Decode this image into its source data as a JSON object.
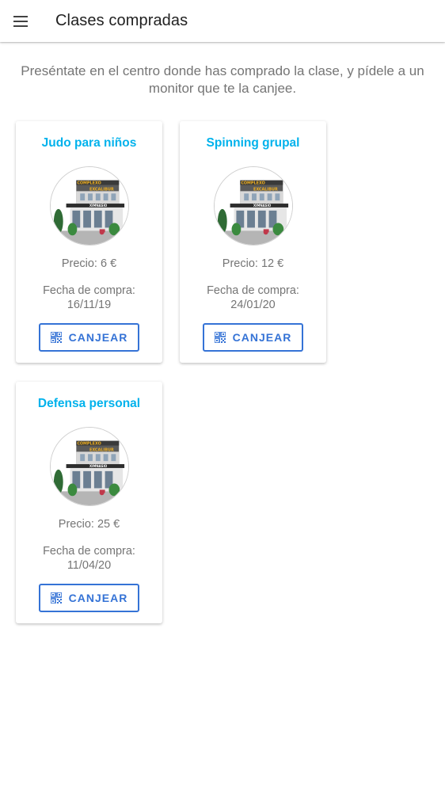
{
  "appbar": {
    "title": "Clases compradas",
    "menu_icon": "menu-icon"
  },
  "intro": {
    "text": "Preséntate en el centro donde has comprado la clase, y pídele a un monitor que te la canjee."
  },
  "colors": {
    "accent_title": "#00b2ec",
    "button": "#3573d6",
    "text_secondary": "#757575"
  },
  "cards": [
    {
      "title": "Judo para niños",
      "price": "Precio: 6 €",
      "date_label": "Fecha de compra:",
      "date_value": "16/11/19",
      "button_label": "CANJEAR",
      "button_icon": "qr-code-icon",
      "image": "gym-building-image"
    },
    {
      "title": "Spinning grupal",
      "price": "Precio: 12 €",
      "date_label": "Fecha de compra:",
      "date_value": "24/01/20",
      "button_label": "CANJEAR",
      "button_icon": "qr-code-icon",
      "image": "gym-building-image"
    },
    {
      "title": "Defensa personal",
      "price": "Precio: 25 €",
      "date_label": "Fecha de compra:",
      "date_value": "11/04/20",
      "button_label": "CANJEAR",
      "button_icon": "qr-code-icon",
      "image": "gym-building-image"
    }
  ],
  "building_sign": {
    "line1": "COMPLEXO",
    "line2": "EXCALIBUR",
    "line3": "XIMNASIO"
  }
}
